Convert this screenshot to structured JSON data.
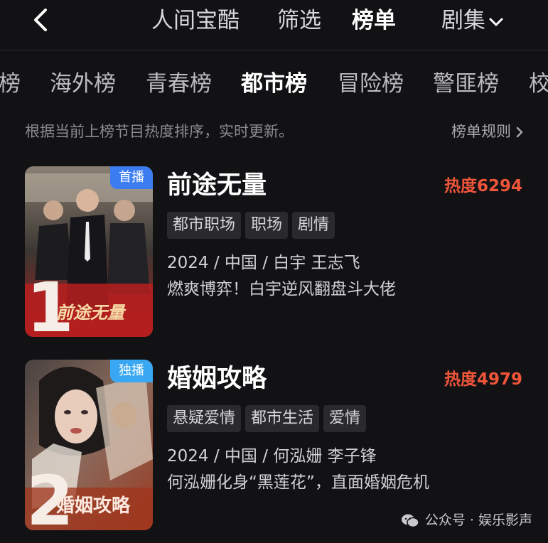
{
  "header": {
    "back_icon": "chevron-left-icon",
    "tabs": [
      {
        "label": "人间宝酷",
        "active": false
      },
      {
        "label": "筛选",
        "active": false
      },
      {
        "label": "榜单",
        "active": true
      },
      {
        "label": "剧集",
        "active": false,
        "dropdown_icon": "chevron-down-icon"
      }
    ]
  },
  "categories": [
    {
      "label": "榜"
    },
    {
      "label": "海外榜"
    },
    {
      "label": "青春榜"
    },
    {
      "label": "都市榜",
      "active": true
    },
    {
      "label": "冒险榜"
    },
    {
      "label": "警匪榜"
    },
    {
      "label": "校"
    }
  ],
  "hint": "根据当前上榜节目热度排序，实时更新。",
  "rules_link": "榜单规则",
  "items": [
    {
      "rank": "1",
      "badge": "首播",
      "title": "前途无量",
      "heat": "热度6294",
      "tags": [
        "都市职场",
        "职场",
        "剧情"
      ],
      "meta": "2024 / 中国 / 白宇  王志飞",
      "desc": "燃爽博弈！白宇逆风翻盘斗大佬",
      "poster_title": "前途无量"
    },
    {
      "rank": "2",
      "badge": "独播",
      "title": "婚姻攻略",
      "heat": "热度4979",
      "tags": [
        "悬疑爱情",
        "都市生活",
        "爱情"
      ],
      "meta": "2024 / 中国 / 何泓姗  李子锋",
      "desc": "何泓姗化身“黑莲花”，直面婚姻危机",
      "poster_title": "婚姻攻略"
    }
  ],
  "watermark": "公众号 · 娱乐影声",
  "colors": {
    "background": "#121215",
    "heat": "#f0553a",
    "badge_blue": "#3b7cf0",
    "badge_cyan": "#39a7f2"
  }
}
